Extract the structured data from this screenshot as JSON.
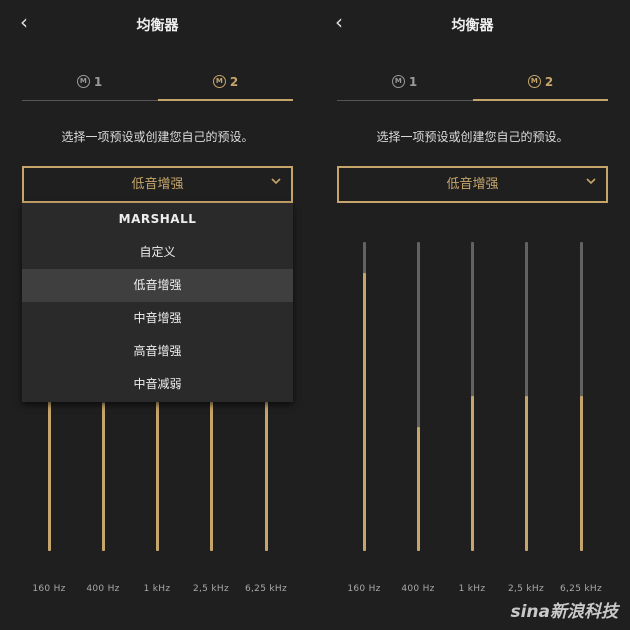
{
  "screens": [
    {
      "id": "left",
      "back_glyph": "‹",
      "title": "均衡器",
      "tabs": [
        {
          "icon_letter": "M",
          "number": "1",
          "active": false
        },
        {
          "icon_letter": "M",
          "number": "2",
          "active": true
        }
      ],
      "prompt": "选择一项预设或创建您自己的预设。",
      "preset_select": {
        "value": "低音增强",
        "open": true
      },
      "dropdown_options": [
        {
          "label": "MARSHALL",
          "selected": false
        },
        {
          "label": "自定义",
          "selected": false
        },
        {
          "label": "低音增强",
          "selected": true
        },
        {
          "label": "中音增强",
          "selected": false
        },
        {
          "label": "高音增强",
          "selected": false
        },
        {
          "label": "中音减弱",
          "selected": false
        }
      ],
      "bands": [
        {
          "label": "160 Hz",
          "level": 1.0
        },
        {
          "label": "400 Hz",
          "level": 0.48
        },
        {
          "label": "1 kHz",
          "level": 0.7
        },
        {
          "label": "2,5 kHz",
          "level": 0.7
        },
        {
          "label": "6,25 kHz",
          "level": 0.7
        }
      ]
    },
    {
      "id": "right",
      "back_glyph": "‹",
      "title": "均衡器",
      "tabs": [
        {
          "icon_letter": "M",
          "number": "1",
          "active": false
        },
        {
          "icon_letter": "M",
          "number": "2",
          "active": true
        }
      ],
      "prompt": "选择一项预设或创建您自己的预设。",
      "preset_select": {
        "value": "低音增强",
        "open": false
      },
      "bands": [
        {
          "label": "160 Hz",
          "level": 0.9
        },
        {
          "label": "400 Hz",
          "level": 0.4
        },
        {
          "label": "1 kHz",
          "level": 0.5
        },
        {
          "label": "2,5 kHz",
          "level": 0.5
        },
        {
          "label": "6,25 kHz",
          "level": 0.5
        }
      ]
    }
  ],
  "watermark": "sina新浪科技",
  "colors": {
    "accent": "#c6a56b",
    "background": "#1f1f1f",
    "track": "#626262",
    "dropdown": "#2a2a2a",
    "selected_option": "#3f3f3f"
  }
}
